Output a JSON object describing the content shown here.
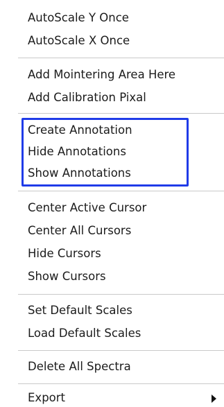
{
  "menu": {
    "groups": [
      {
        "items": [
          {
            "label": "AutoScale Y Once"
          },
          {
            "label": "AutoScale X Once"
          }
        ]
      },
      {
        "items": [
          {
            "label": "Add Mointering Area Here"
          },
          {
            "label": "Add Calibration Pixal"
          }
        ]
      },
      {
        "items": [
          {
            "label": "Create Annotation"
          },
          {
            "label": "Hide Annotations"
          },
          {
            "label": "Show Annotations"
          }
        ]
      },
      {
        "items": [
          {
            "label": "Center Active Cursor"
          },
          {
            "label": "Center All Cursors"
          },
          {
            "label": "Hide Cursors"
          },
          {
            "label": "Show Cursors"
          }
        ]
      },
      {
        "items": [
          {
            "label": "Set Default Scales"
          },
          {
            "label": "Load Default Scales"
          }
        ]
      },
      {
        "items": [
          {
            "label": "Delete All Spectra"
          }
        ]
      },
      {
        "items": [
          {
            "label": "Export",
            "has_submenu": true,
            "icon": "chevron-right-icon"
          }
        ]
      }
    ],
    "highlight_color": "#1f3be8"
  }
}
